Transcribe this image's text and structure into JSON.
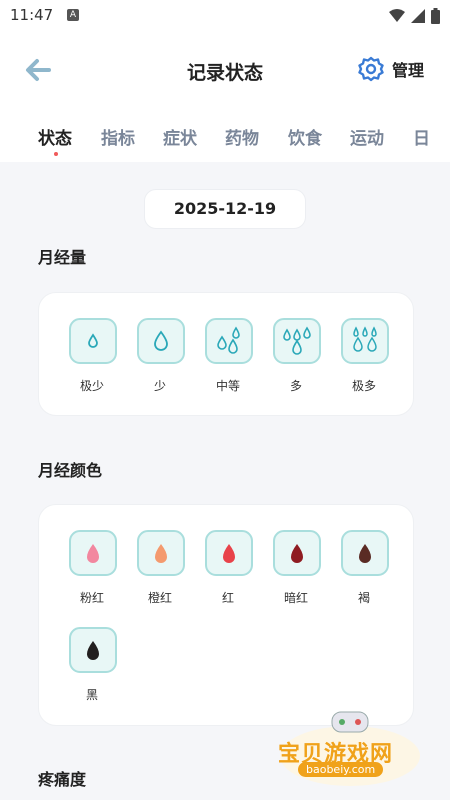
{
  "status_bar": {
    "time": "11:47",
    "notif_label": "A"
  },
  "header": {
    "title": "记录状态",
    "manage_label": "管理"
  },
  "tabs": [
    {
      "label": "状态",
      "active": true
    },
    {
      "label": "指标"
    },
    {
      "label": "症状"
    },
    {
      "label": "药物"
    },
    {
      "label": "饮食"
    },
    {
      "label": "运动"
    },
    {
      "label": "日"
    }
  ],
  "date": "2025-12-19",
  "flow": {
    "title": "月经量",
    "options": [
      {
        "label": "极少",
        "icon": "single-small-drop-icon"
      },
      {
        "label": "少",
        "icon": "single-drop-icon"
      },
      {
        "label": "中等",
        "icon": "three-drops-icon"
      },
      {
        "label": "多",
        "icon": "four-drops-icon"
      },
      {
        "label": "极多",
        "icon": "many-drops-icon"
      }
    ]
  },
  "color": {
    "title": "月经颜色",
    "options": [
      {
        "label": "粉红",
        "color": "#f2879f"
      },
      {
        "label": "橙红",
        "color": "#f49a6e"
      },
      {
        "label": "红",
        "color": "#e8434a"
      },
      {
        "label": "暗红",
        "color": "#8f1c22"
      },
      {
        "label": "褐",
        "color": "#5a2b24"
      },
      {
        "label": "黑",
        "color": "#221f1f"
      }
    ]
  },
  "pain": {
    "title": "疼痛度"
  },
  "watermark": {
    "text": "宝贝游戏网",
    "url": "baobeiy.com"
  },
  "colors": {
    "accent_teal": "#a9dedd",
    "drop_blue": "#2aa8b8",
    "tab_dot": "#f05a5a"
  }
}
